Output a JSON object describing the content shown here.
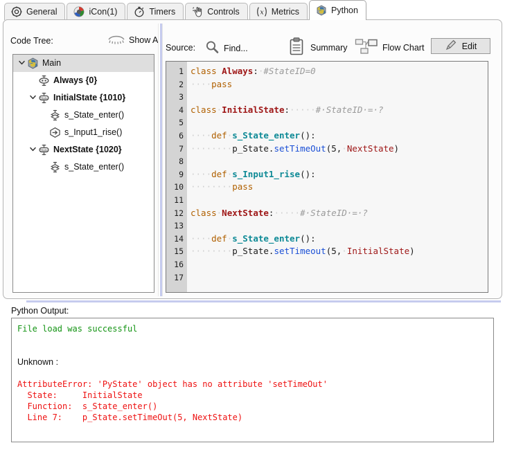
{
  "tabs": [
    {
      "label": "General",
      "icon": "gear-icon",
      "active": false
    },
    {
      "label": "iCon(1)",
      "icon": "icon-badge-icon",
      "active": false
    },
    {
      "label": "Timers",
      "icon": "stopwatch-icon",
      "active": false
    },
    {
      "label": "Controls",
      "icon": "hand-click-icon",
      "active": false
    },
    {
      "label": "Metrics",
      "icon": "variable-x-icon",
      "active": false
    },
    {
      "label": "Python",
      "icon": "python-logo-icon",
      "active": true
    }
  ],
  "code_tree": {
    "title": "Code Tree:",
    "show_all_label": "Show All",
    "show_all_icon": "eye-icon",
    "nodes": [
      {
        "label": "Main",
        "icon": "python-logo-icon",
        "twisty": "expanded",
        "indent": 0,
        "bold": false,
        "selected": true
      },
      {
        "label": "Always {0}",
        "icon": "state-always-icon",
        "twisty": "none",
        "indent": 1,
        "bold": true,
        "selected": false
      },
      {
        "label": "InitialState {1010}",
        "icon": "state-icon",
        "twisty": "expanded",
        "indent": 1,
        "bold": true,
        "selected": false
      },
      {
        "label": "s_State_enter()",
        "icon": "state-enter-icon",
        "twisty": "none",
        "indent": 2,
        "bold": false,
        "selected": false
      },
      {
        "label": "s_Input1_rise()",
        "icon": "input-rise-icon",
        "twisty": "none",
        "indent": 2,
        "bold": false,
        "selected": false
      },
      {
        "label": "NextState {1020}",
        "icon": "state-icon",
        "twisty": "expanded",
        "indent": 1,
        "bold": true,
        "selected": false
      },
      {
        "label": "s_State_enter()",
        "icon": "state-enter-icon",
        "twisty": "none",
        "indent": 2,
        "bold": false,
        "selected": false
      }
    ]
  },
  "source": {
    "title": "Source:",
    "find_label": "Find...",
    "find_icon": "magnifier-icon",
    "summary_label": "Summary",
    "summary_icon": "clipboard-icon",
    "flowchart_label": "Flow Chart",
    "flowchart_icon": "flowchart-icon",
    "edit_label": "Edit",
    "edit_icon": "pencil-icon"
  },
  "editor": {
    "line_numbers": [
      "1",
      "2",
      "3",
      "4",
      "5",
      "6",
      "7",
      "8",
      "9",
      "10",
      "11",
      "12",
      "13",
      "14",
      "15",
      "16",
      "17"
    ],
    "lines": [
      [
        {
          "t": "class ",
          "c": "kw"
        },
        {
          "t": "Always",
          "c": "cn"
        },
        {
          "t": ":",
          "c": "pl"
        },
        {
          "t": "·",
          "c": "ws"
        },
        {
          "t": "#StateID=0",
          "c": "cm"
        }
      ],
      [
        {
          "t": "····",
          "c": "ws"
        },
        {
          "t": "pass",
          "c": "kw"
        }
      ],
      [],
      [
        {
          "t": "class",
          "c": "kw"
        },
        {
          "t": "·",
          "c": "ws"
        },
        {
          "t": "InitialState",
          "c": "cn"
        },
        {
          "t": ":",
          "c": "pl"
        },
        {
          "t": "·····",
          "c": "ws"
        },
        {
          "t": "#·StateID·=·?",
          "c": "cm"
        }
      ],
      [],
      [
        {
          "t": "····",
          "c": "ws"
        },
        {
          "t": "def",
          "c": "kw"
        },
        {
          "t": "·",
          "c": "ws"
        },
        {
          "t": "s_State_enter",
          "c": "fn"
        },
        {
          "t": "():",
          "c": "pl"
        }
      ],
      [
        {
          "t": "········",
          "c": "ws"
        },
        {
          "t": "p_State.",
          "c": "pl"
        },
        {
          "t": "setTimeOut",
          "c": "mt"
        },
        {
          "t": "(5,",
          "c": "pl"
        },
        {
          "t": "·",
          "c": "ws"
        },
        {
          "t": "NextState",
          "c": "rf"
        },
        {
          "t": ")",
          "c": "pl"
        }
      ],
      [],
      [
        {
          "t": "····",
          "c": "ws"
        },
        {
          "t": "def",
          "c": "kw"
        },
        {
          "t": "·",
          "c": "ws"
        },
        {
          "t": "s_Input1_rise",
          "c": "fn"
        },
        {
          "t": "():",
          "c": "pl"
        }
      ],
      [
        {
          "t": "········",
          "c": "ws"
        },
        {
          "t": "pass",
          "c": "kw"
        }
      ],
      [],
      [
        {
          "t": "class",
          "c": "kw"
        },
        {
          "t": "·",
          "c": "ws"
        },
        {
          "t": "NextState",
          "c": "cn"
        },
        {
          "t": ":",
          "c": "pl"
        },
        {
          "t": "·····",
          "c": "ws"
        },
        {
          "t": "#·StateID·=·?",
          "c": "cm"
        }
      ],
      [],
      [
        {
          "t": "····",
          "c": "ws"
        },
        {
          "t": "def",
          "c": "kw"
        },
        {
          "t": "·",
          "c": "ws"
        },
        {
          "t": "s_State_enter",
          "c": "fn"
        },
        {
          "t": "():",
          "c": "pl"
        }
      ],
      [
        {
          "t": "········",
          "c": "ws"
        },
        {
          "t": "p_State.",
          "c": "pl"
        },
        {
          "t": "setTimeout",
          "c": "mt"
        },
        {
          "t": "(5,",
          "c": "pl"
        },
        {
          "t": "·",
          "c": "ws"
        },
        {
          "t": "InitialState",
          "c": "rf"
        },
        {
          "t": ")",
          "c": "pl"
        }
      ],
      [],
      []
    ]
  },
  "output": {
    "title": "Python Output:",
    "lines": [
      {
        "text": "File load was successful",
        "style": "green"
      },
      {
        "text": "",
        "style": "blank"
      },
      {
        "text": "",
        "style": "blank"
      },
      {
        "text": "Unknown :",
        "style": "plain"
      },
      {
        "text": "",
        "style": "blank"
      },
      {
        "text": "AttributeError: 'PyState' object has no attribute 'setTimeOut'",
        "style": "red"
      },
      {
        "text": "  State:     InitialState",
        "style": "red"
      },
      {
        "text": "  Function:  s_State_enter()",
        "style": "red"
      },
      {
        "text": "  Line 7:    p_State.setTimeOut(5, NextState)",
        "style": "red"
      }
    ]
  },
  "colors": {
    "accent_splitter": "#c6cbee",
    "active_tab_bg": "#ffffff",
    "inactive_tab_bg": "#f0f0f0",
    "tree_selection": "#dedede",
    "gutter_bg": "#d4d4d4",
    "error_red": "#ee1111",
    "success_green": "#149414"
  }
}
